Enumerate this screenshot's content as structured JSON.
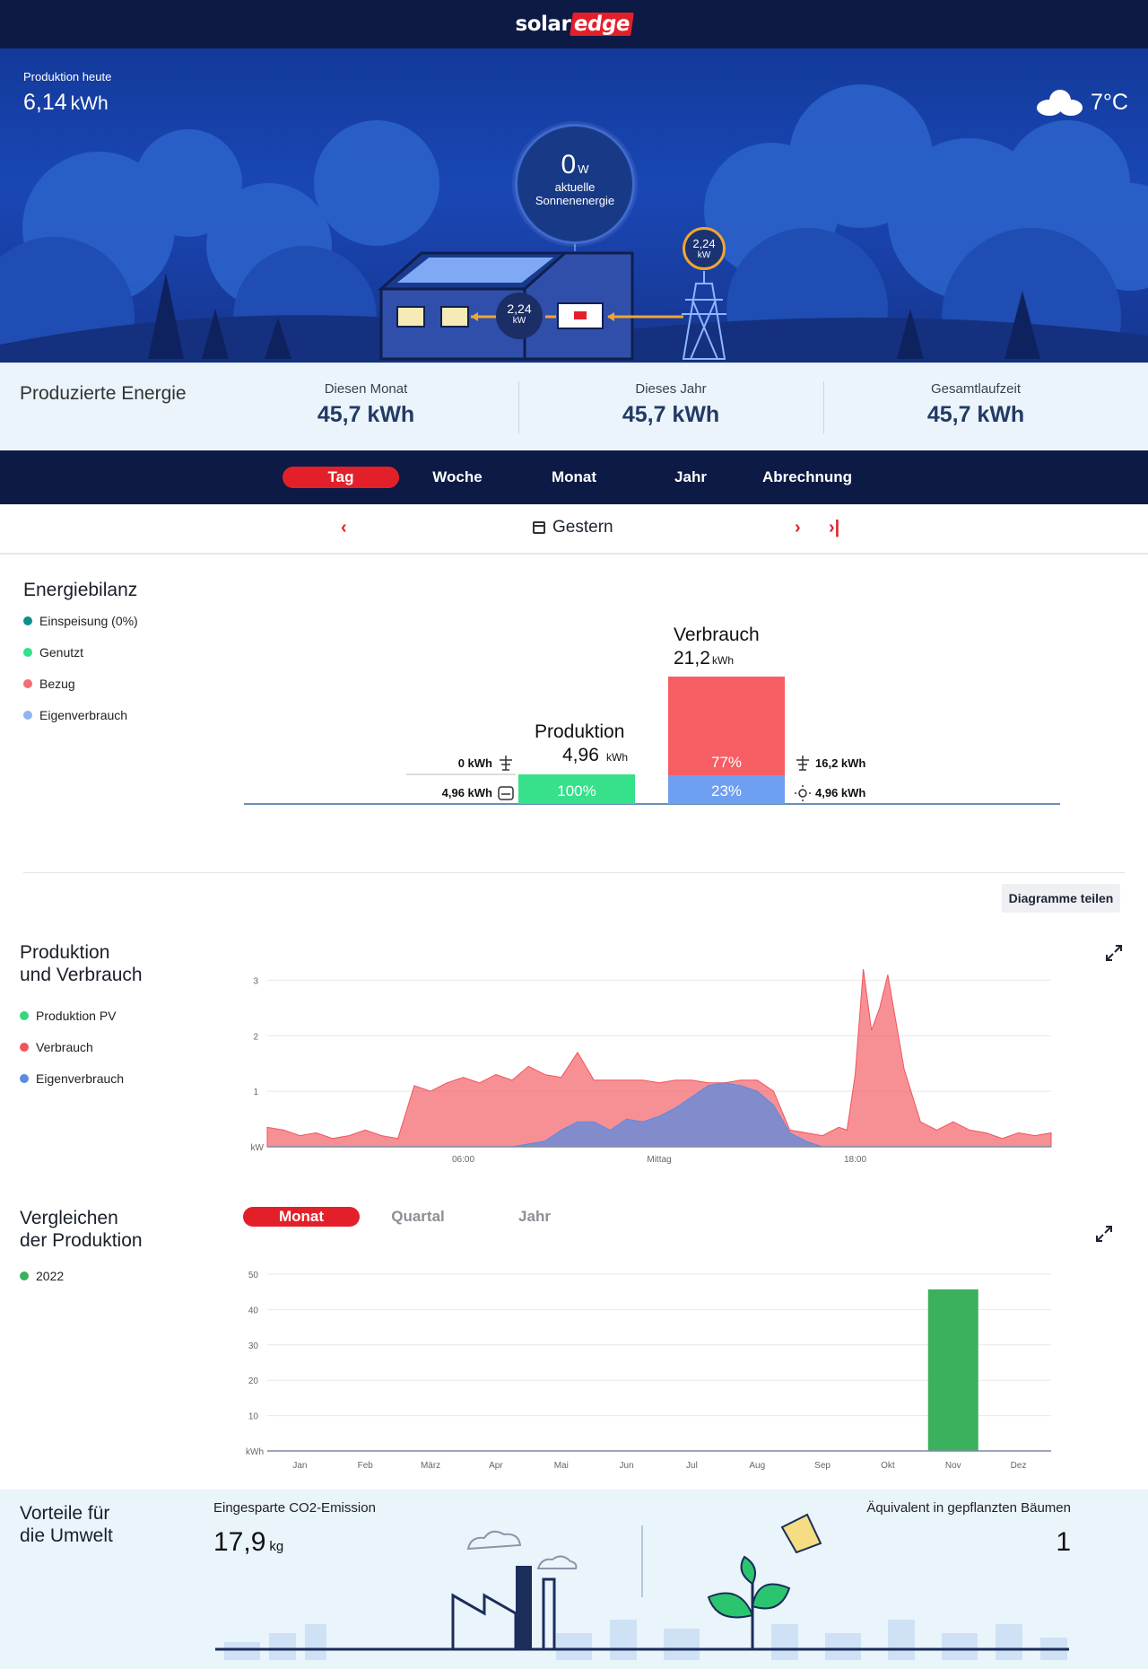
{
  "brand": {
    "logo_solar": "solar",
    "logo_edge": "edge"
  },
  "hero": {
    "prod_today_label": "Produktion heute",
    "prod_today_value": "6,14",
    "prod_today_unit": "kWh",
    "temperature": "7°C",
    "weather_icon": "cloud-icon",
    "current_power_value": "0",
    "current_power_unit": "W",
    "current_power_label_1": "aktuelle",
    "current_power_label_2": "Sonnenenergie",
    "grid_flow_value": "2,24",
    "grid_flow_unit": "kW",
    "house_flow_value": "2,24",
    "house_flow_unit": "kW"
  },
  "produced": {
    "title": "Produzierte Energie",
    "cols": [
      {
        "label": "Diesen Monat",
        "value": "45,7 kWh"
      },
      {
        "label": "Dieses Jahr",
        "value": "45,7 kWh"
      },
      {
        "label": "Gesamtlaufzeit",
        "value": "45,7 kWh"
      }
    ]
  },
  "tabs": [
    "Tag",
    "Woche",
    "Monat",
    "Jahr",
    "Abrechnung"
  ],
  "active_tab": "Tag",
  "datenav": {
    "date_label": "Gestern",
    "prev_icon": "chevron-left-icon",
    "next_icon": "chevron-right-icon",
    "last_icon": "skip-to-end-icon",
    "calendar_icon": "calendar-icon"
  },
  "balance": {
    "title": "Energiebilanz",
    "legend": [
      {
        "label": "Einspeisung (0%)",
        "color": "#0f8f8c"
      },
      {
        "label": "Genutzt",
        "color": "#2ee38c"
      },
      {
        "label": "Bezug",
        "color": "#f46d74"
      },
      {
        "label": "Eigenverbrauch",
        "color": "#8fb5ef"
      }
    ],
    "production_title": "Produktion",
    "production_value": "4,96",
    "production_unit": "kWh",
    "production_pct": "100%",
    "consumption_title": "Verbrauch",
    "consumption_value": "21,2",
    "consumption_unit": "kWh",
    "consumption_import_pct": "77%",
    "consumption_self_pct": "23%",
    "export_label": "0 kWh",
    "used_label": "4,96 kWh",
    "import_label": "16,2 kWh",
    "self_label": "4,96 kWh"
  },
  "share_button": "Diagramme teilen",
  "prodcons": {
    "title_1": "Produktion",
    "title_2": "und Verbrauch",
    "legend": [
      {
        "label": "Produktion PV",
        "color": "#33d77f"
      },
      {
        "label": "Verbrauch",
        "color": "#f2545b"
      },
      {
        "label": "Eigenverbrauch",
        "color": "#5b8be0"
      }
    ]
  },
  "compare": {
    "title_1": "Vergleichen",
    "title_2": "der Produktion",
    "tabs": [
      "Monat",
      "Quartal",
      "Jahr"
    ],
    "active_tab": "Monat",
    "legend": [
      {
        "label": "2022",
        "color": "#3bb15e"
      }
    ]
  },
  "environment": {
    "title_1": "Vorteile für",
    "title_2": "die Umwelt",
    "co2_label": "Eingesparte CO2-Emission",
    "co2_value": "17,9",
    "co2_unit": "kg",
    "trees_label": "Äquivalent in gepflanzten Bäumen",
    "trees_value": "1"
  },
  "chart_data": [
    {
      "type": "area",
      "title": "Produktion und Verbrauch",
      "ylabel": "kW",
      "ylim": [
        0,
        3.2
      ],
      "yticks": [
        "1",
        "2",
        "3"
      ],
      "x_tick_labels": [
        "06:00",
        "Mittag",
        "18:00"
      ],
      "x_hours": [
        0,
        0.5,
        1,
        1.5,
        2,
        2.5,
        3,
        3.5,
        4,
        4.5,
        5,
        5.5,
        6,
        6.5,
        7,
        7.5,
        8,
        8.5,
        9,
        9.5,
        10,
        10.5,
        11,
        11.5,
        12,
        12.5,
        13,
        13.5,
        14,
        14.5,
        15,
        15.5,
        16,
        16.5,
        17,
        17.5,
        17.75,
        18,
        18.25,
        18.5,
        18.75,
        19,
        19.5,
        20,
        20.5,
        21,
        21.5,
        22,
        22.5,
        23,
        23.5,
        24
      ],
      "series": [
        {
          "name": "Verbrauch",
          "color": "#f2545b",
          "values": [
            0.35,
            0.3,
            0.2,
            0.25,
            0.15,
            0.2,
            0.3,
            0.2,
            0.15,
            1.1,
            1.0,
            1.15,
            1.25,
            1.15,
            1.3,
            1.2,
            1.45,
            1.3,
            1.25,
            1.7,
            1.2,
            1.2,
            1.2,
            1.2,
            1.15,
            1.2,
            1.2,
            1.15,
            1.15,
            1.2,
            1.2,
            1.0,
            0.3,
            0.25,
            0.2,
            0.35,
            0.3,
            1.3,
            3.2,
            2.1,
            2.5,
            3.1,
            1.4,
            0.45,
            0.3,
            0.45,
            0.3,
            0.25,
            0.15,
            0.25,
            0.2,
            0.25
          ]
        },
        {
          "name": "Eigenverbrauch",
          "color": "#5b8be0",
          "values": [
            0,
            0,
            0,
            0,
            0,
            0,
            0,
            0,
            0,
            0,
            0,
            0,
            0,
            0,
            0,
            0,
            0.05,
            0.1,
            0.3,
            0.45,
            0.45,
            0.3,
            0.5,
            0.45,
            0.55,
            0.7,
            0.9,
            1.1,
            1.15,
            1.1,
            1.0,
            0.75,
            0.25,
            0.1,
            0,
            0,
            0,
            0,
            0,
            0,
            0,
            0,
            0,
            0,
            0,
            0,
            0,
            0,
            0,
            0,
            0,
            0
          ]
        }
      ]
    },
    {
      "type": "bar",
      "title": "Vergleichen der Produktion",
      "ylabel": "kWh",
      "ylim": [
        0,
        50
      ],
      "yticks": [
        "10",
        "20",
        "30",
        "40",
        "50"
      ],
      "categories": [
        "Jan",
        "Feb",
        "März",
        "Apr",
        "Mai",
        "Jun",
        "Jul",
        "Aug",
        "Sep",
        "Okt",
        "Nov",
        "Dez"
      ],
      "series": [
        {
          "name": "2022",
          "color": "#3bb15e",
          "values": [
            0,
            0,
            0,
            0,
            0,
            0,
            0,
            0,
            0,
            0,
            45.7,
            0
          ]
        }
      ]
    }
  ]
}
